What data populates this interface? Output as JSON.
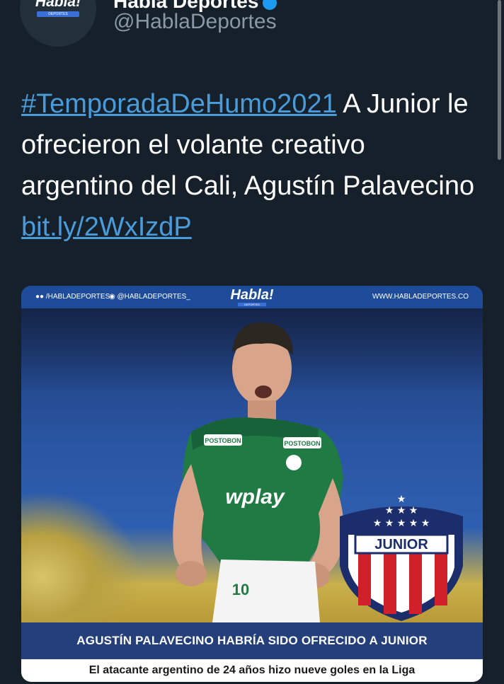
{
  "account": {
    "display_name": "Habla Deportes",
    "handle": "@HablaDeportes",
    "avatar_logo": "Habla!",
    "avatar_sub": "DEPORTES"
  },
  "tweet": {
    "hashtag": "#TemporadaDeHumo2021",
    "text": " A Junior le ofrecieron el volante creativo argentino del Cali, Agustín Palavecino ",
    "link": "bit.ly/2WxIzdP"
  },
  "card": {
    "social_left": "/HABLADEPORTES",
    "social_mid": "@HABLADEPORTES_",
    "logo": "Habla!",
    "logo_sub": "DEPORTES",
    "site": "WWW.HABLADEPORTES.CO",
    "jersey_sponsor": "wplay",
    "jersey_sponsor_top": "POSTOBON",
    "jersey_number": "10",
    "badge_text": "JUNIOR",
    "headline": "AGUSTÍN PALAVECINO HABRÍA SIDO OFRECIDO A JUNIOR",
    "subline": "El atacante argentino de 24 años hizo nueve goles en la Liga"
  },
  "colors": {
    "background": "#15202b",
    "link": "#4a9bd9",
    "secondary_text": "#8b98a5",
    "card_bar": "#243f7a"
  }
}
